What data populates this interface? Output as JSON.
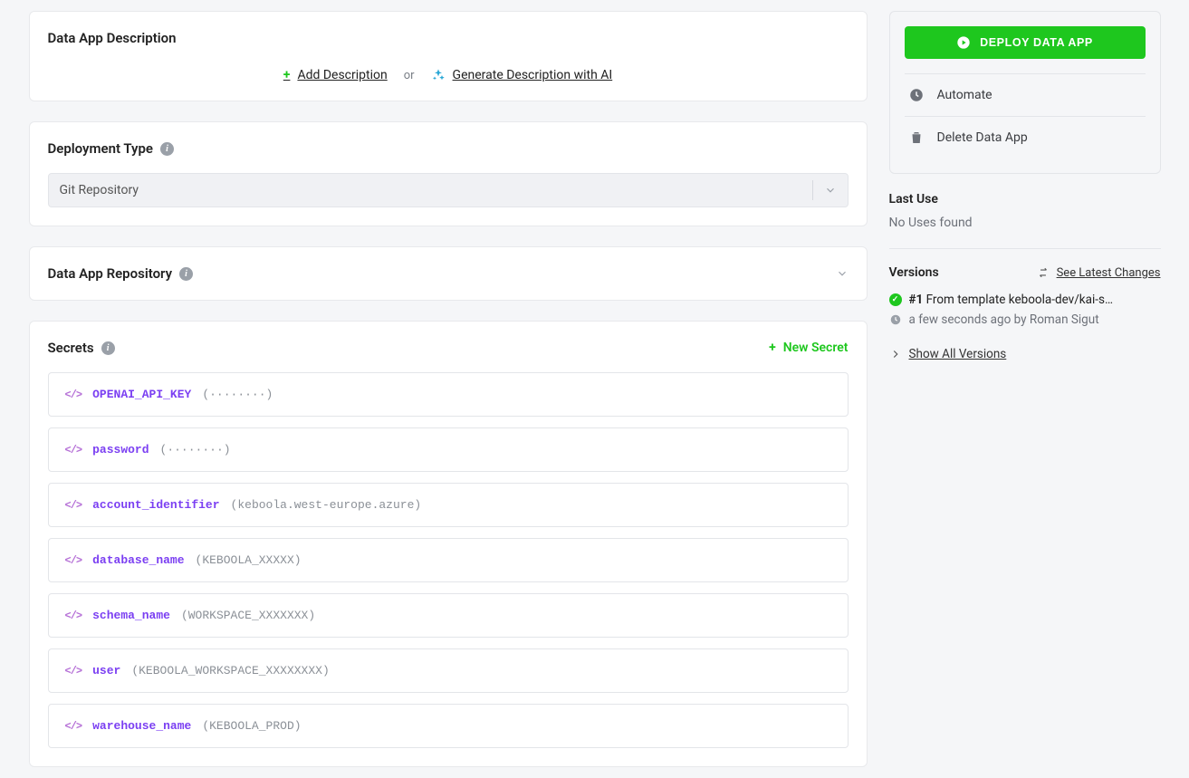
{
  "description": {
    "title": "Data App Description",
    "add_label": "Add Description",
    "or": "or",
    "ai_label": "Generate Description with AI"
  },
  "deployment": {
    "title": "Deployment Type",
    "selected": "Git Repository"
  },
  "repository": {
    "title": "Data App Repository"
  },
  "secrets": {
    "title": "Secrets",
    "new_label": "New Secret",
    "items": [
      {
        "name": "OPENAI_API_KEY",
        "value": "(········)"
      },
      {
        "name": "password",
        "value": "(········)"
      },
      {
        "name": "account_identifier",
        "value": "(keboola.west-europe.azure)"
      },
      {
        "name": "database_name",
        "value": "(KEBOOLA_XXXXX)"
      },
      {
        "name": "schema_name",
        "value": "(WORKSPACE_XXXXXXX)"
      },
      {
        "name": "user",
        "value": "(KEBOOLA_WORKSPACE_XXXXXXXX)"
      },
      {
        "name": "warehouse_name",
        "value": "(KEBOOLA_PROD)"
      }
    ]
  },
  "side": {
    "deploy_label": "DEPLOY DATA APP",
    "automate_label": "Automate",
    "delete_label": "Delete Data App",
    "last_use_title": "Last Use",
    "last_use_status": "No Uses found",
    "versions_title": "Versions",
    "see_changes_label": "See Latest Changes",
    "version_number": "#1",
    "version_desc": "From template keboola-dev/kai-sql...",
    "version_time": "a few seconds ago by Roman Sigut",
    "show_all_label": "Show All Versions"
  }
}
